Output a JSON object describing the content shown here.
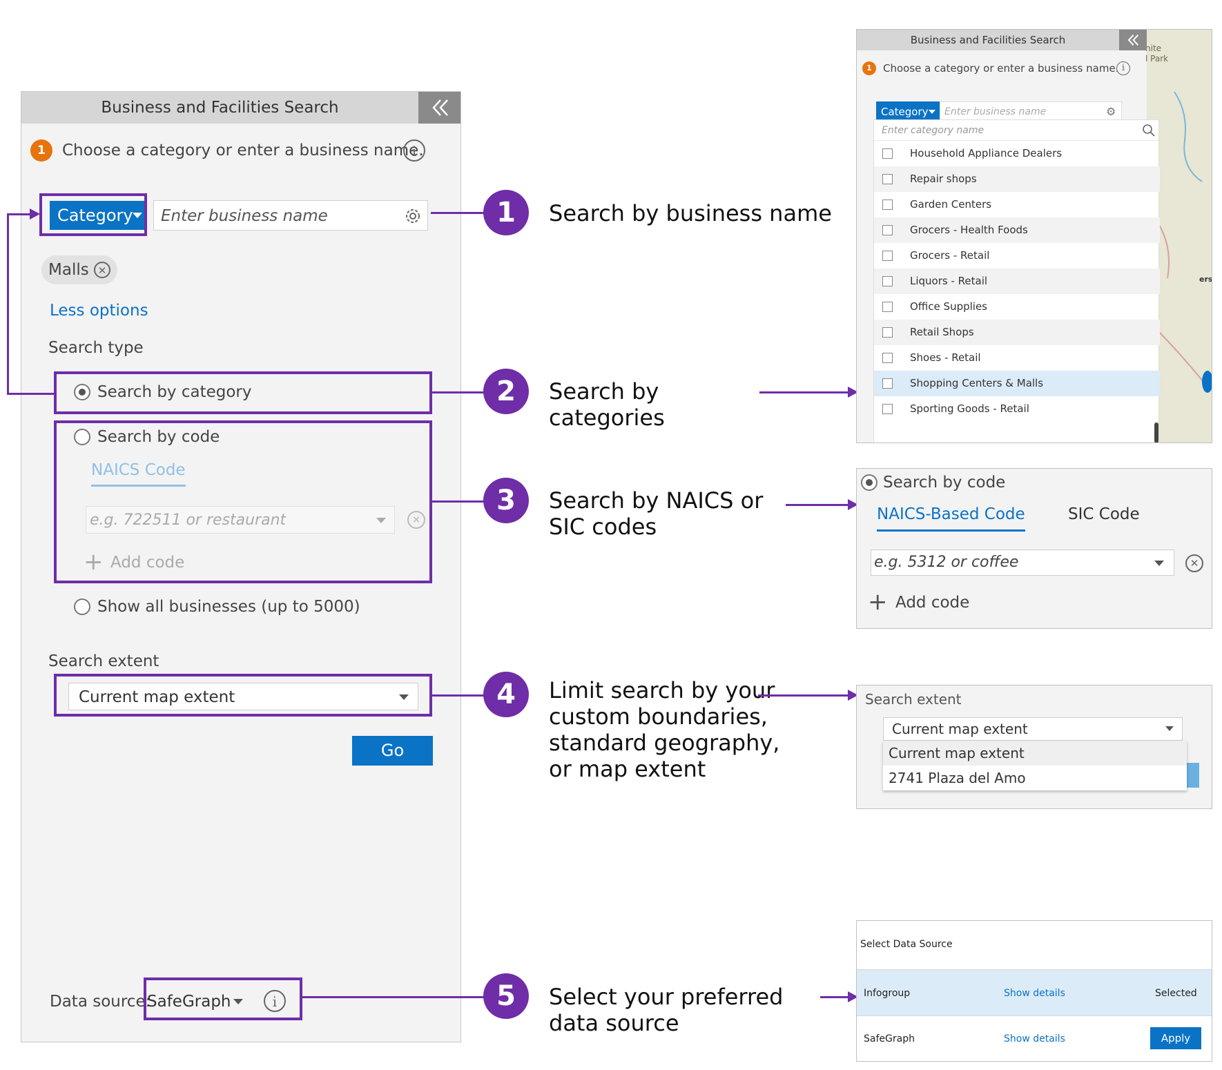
{
  "main_panel": {
    "title": "Business and Facilities Search",
    "step_badge": "1",
    "instruction": "Choose a category or enter a business name.",
    "category_button": "Category",
    "business_placeholder": "Enter business name",
    "chip": "Malls",
    "less_options": "Less options",
    "search_type_label": "Search type",
    "search_by_category": "Search by category",
    "search_by_code": "Search by code",
    "naics_tab": "NAICS Code",
    "code_placeholder": "e.g. 722511 or restaurant",
    "add_code": "Add code",
    "show_all": "Show all businesses (up to 5000)",
    "search_extent_label": "Search extent",
    "extent_value": "Current map extent",
    "go_button": "Go",
    "data_source_label": "Data source:",
    "data_source_value": "SafeGraph"
  },
  "steps": [
    {
      "number": "1",
      "text": "Search by business name"
    },
    {
      "number": "2",
      "text": "Search by categories"
    },
    {
      "number": "3",
      "text": "Search by NAICS or SIC codes"
    },
    {
      "number": "4",
      "text": "Limit search by your custom boundaries, standard geography, or map extent"
    },
    {
      "number": "5",
      "text": "Select your preferred data source"
    }
  ],
  "category_panel": {
    "title": "Business and Facilities Search",
    "step_badge": "1",
    "instruction": "Choose a category or enter a business name.",
    "category_button": "Category",
    "business_placeholder": "Enter business name",
    "category_placeholder": "Enter category name",
    "map_labels": [
      "nite",
      "l Park",
      "ers"
    ],
    "items": [
      "Household Appliance Dealers",
      "Repair shops",
      "Garden Centers",
      "Grocers - Health Foods",
      "Grocers - Retail",
      "Liquors - Retail",
      "Office Supplies",
      "Retail Shops",
      "Shoes - Retail",
      "Shopping Centers & Malls",
      "Sporting Goods - Retail"
    ]
  },
  "code_panel": {
    "search_by_code": "Search by code",
    "naics_tab": "NAICS-Based Code",
    "sic_tab": "SIC Code",
    "placeholder": "e.g. 5312 or coffee",
    "add_code": "Add code"
  },
  "extent_panel": {
    "label": "Search extent",
    "selected": "Current map extent",
    "options": [
      "Current map extent",
      "2741 Plaza del Amo"
    ]
  },
  "source_panel": {
    "title": "Select Data Source",
    "rows": [
      {
        "name": "Infogroup",
        "details": "Show details",
        "status": "Selected"
      },
      {
        "name": "SafeGraph",
        "details": "Show details",
        "status": "Apply"
      }
    ]
  },
  "colors": {
    "accent": "#6f2da8",
    "blue": "#0a73c5",
    "badge": "#e8730c"
  }
}
